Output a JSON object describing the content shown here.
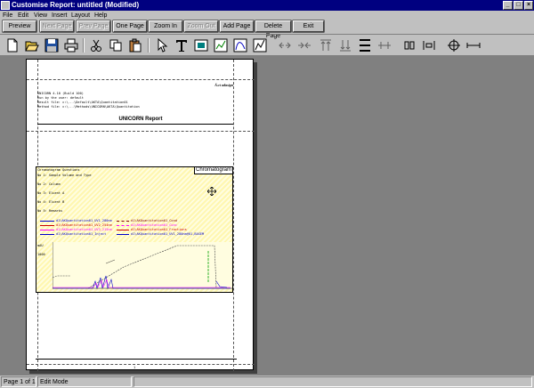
{
  "window": {
    "title": "Customise Report: untitled (Modified)"
  },
  "titlebar_buttons": [
    "_",
    "□",
    "×"
  ],
  "menu": [
    "File",
    "Edit",
    "View",
    "Insert",
    "Layout",
    "Help"
  ],
  "buttons": [
    {
      "label": "Preview",
      "enabled": true
    },
    {
      "label": "Next Page",
      "enabled": false
    },
    {
      "label": "Prev Page",
      "enabled": false
    },
    {
      "label": "One Page",
      "enabled": true
    },
    {
      "label": "Zoom In",
      "enabled": true
    },
    {
      "label": "Zoom Out",
      "enabled": false
    },
    {
      "label": "Add Page",
      "enabled": true
    },
    {
      "label": "Delete Page",
      "enabled": true
    },
    {
      "label": "Exit",
      "enabled": true
    }
  ],
  "toolbar_icons": [
    "new-document-icon",
    "open-folder-icon",
    "save-icon",
    "print-icon",
    "cut-icon",
    "copy-icon",
    "paste-icon",
    "pointer-icon",
    "text-icon",
    "image-icon",
    "chart-icon",
    "curve-icon",
    "table-icon",
    "align-left-icon",
    "align-right-icon",
    "align-top-icon",
    "align-bottom-icon",
    "same-height-icon",
    "center-horizontal-icon",
    "center-vertical-icon",
    "space-across-icon",
    "space-down-icon"
  ],
  "page": {
    "header_right": "Ä‹ct adasign",
    "meta_lines": [
      "UNICORN 4.10 (Build 100)",
      "Run by the user:    default",
      "Result file: c:\\...\\Default\\AKTA\\Quantitation01",
      "Method file: c:\\...\\Methods\\UNICORN\\AKTA\\Quantitation"
    ],
    "report_title": "UNICORN Report",
    "chrom_label": "Chromatogram",
    "chrom_lines": [
      "Chromatogram Questions",
      "No 1:   Sample Volume and Type",
      "No 2:   Column",
      "No 3:   Eluent A",
      "No 4:   Eluent B",
      "No 5:   Remarks"
    ],
    "legend": [
      {
        "text": "d1\\AKQuantitation01_UV1_280nm",
        "color": "#0000cc"
      },
      {
        "text": "d1\\AKQuantitation01_UV2_254nm",
        "color": "#cc0000"
      },
      {
        "text": "d1\\AKQuantitation01_UV3_215nm",
        "color": "#ff00ff"
      },
      {
        "text": "d1\\AKQuantitation01_Cond",
        "color": "#800000"
      },
      {
        "text": "d1\\AKQuantitation01_Conc",
        "color": "#ff00ff"
      },
      {
        "text": "d1\\AKQuantitation01_Fractions",
        "color": "#cc0000"
      },
      {
        "text": "d1\\AKQuantitation01_Inject",
        "color": "#0000cc"
      },
      {
        "text": "d1\\AKQuantitation01_UV1_280nm@01,BASEM",
        "color": "#0000cc"
      }
    ],
    "y_unit": "mAU",
    "y_tick": "1000",
    "page_number": "1"
  },
  "status": {
    "page": "Page 1 of 1",
    "mode": "Edit Mode"
  }
}
